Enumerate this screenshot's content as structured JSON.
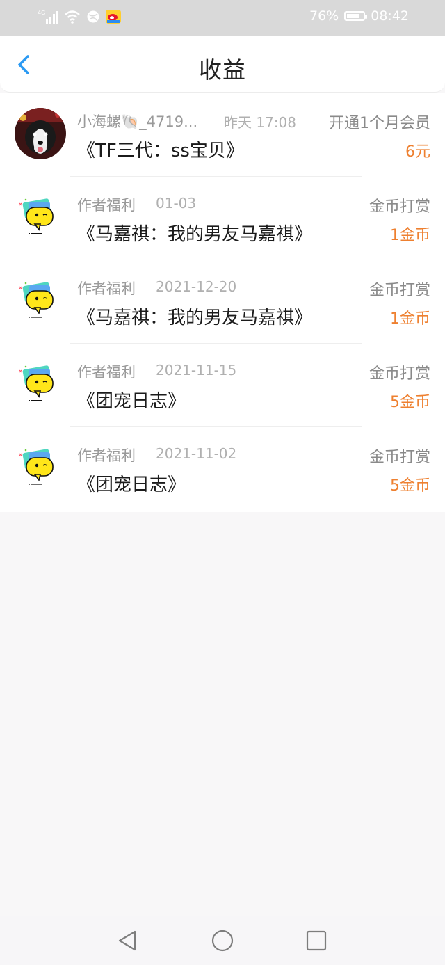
{
  "status_bar": {
    "network": "4G",
    "battery": "76%",
    "battery_level": 0.76,
    "time": "08:42"
  },
  "header": {
    "title": "收益"
  },
  "items": [
    {
      "source": "小海螺🐚_4719...",
      "date": "昨天 17:08",
      "type": "开通1个月会员",
      "title": "《TF三代：ss宝贝》",
      "amount": "6元",
      "avatar": "dog-photo-avatar"
    },
    {
      "source": "作者福利",
      "date": "01-03",
      "type": "金币打赏",
      "title": "《马嘉祺：我的男友马嘉祺》",
      "amount": "1金币",
      "avatar": "speech-bubble-avatar"
    },
    {
      "source": "作者福利",
      "date": "2021-12-20",
      "type": "金币打赏",
      "title": "《马嘉祺：我的男友马嘉祺》",
      "amount": "1金币",
      "avatar": "speech-bubble-avatar"
    },
    {
      "source": "作者福利",
      "date": "2021-11-15",
      "type": "金币打赏",
      "title": "《团宠日志》",
      "amount": "5金币",
      "avatar": "speech-bubble-avatar"
    },
    {
      "source": "作者福利",
      "date": "2021-11-02",
      "type": "金币打赏",
      "title": "《团宠日志》",
      "amount": "5金币",
      "avatar": "speech-bubble-avatar"
    }
  ],
  "colors": {
    "accent": "#2b9af3",
    "amount": "#ee8030",
    "background": "#f8f7f8"
  },
  "system_nav": {
    "back": "back-triangle-icon",
    "home": "home-circle-icon",
    "recents": "recents-square-icon"
  }
}
